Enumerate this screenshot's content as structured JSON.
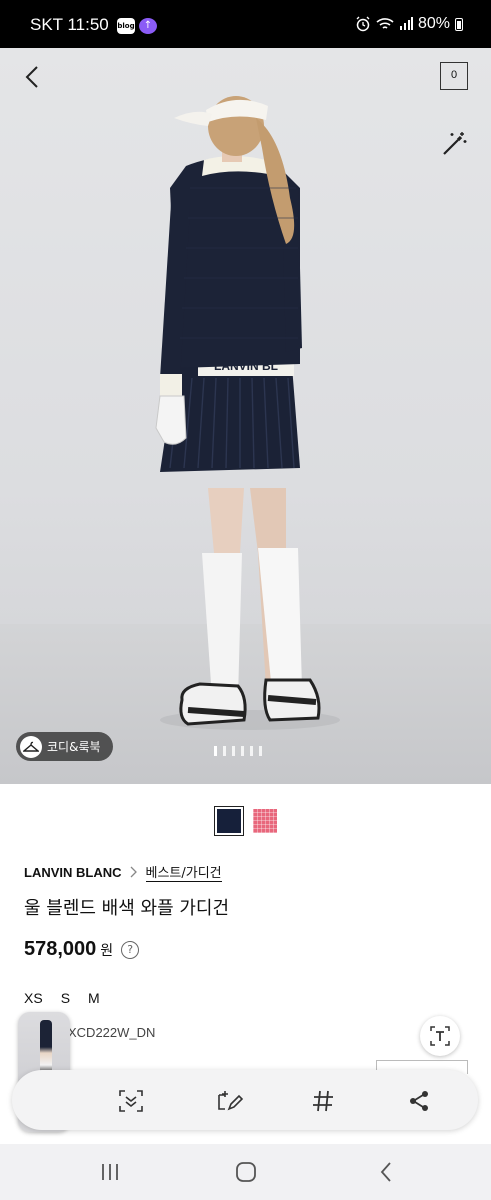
{
  "status_bar": {
    "time": "SKT 11:50",
    "blog_chip": "blog",
    "upload_chip": "↑",
    "battery": "80%"
  },
  "hero": {
    "cart_count": "0",
    "codi_label": "코디&룩북",
    "slide_count": 6,
    "active_slide": 1,
    "logo_band_text": "LANVIN BL"
  },
  "product": {
    "colors": [
      {
        "name": "navy",
        "hex": "#16203a"
      },
      {
        "name": "pink",
        "hex": "#e8677c"
      }
    ],
    "brand": "LANVIN BLANC",
    "category": "베스트/가디건",
    "title": "울 블렌드 배색 와플 가디건",
    "price": "578,000",
    "currency": "원",
    "help": "?",
    "sizes": [
      "XS",
      "S",
      "M"
    ],
    "sku": "XCD222W_DN"
  },
  "toolbar": {
    "icons": [
      "scan-icon",
      "edit-icon",
      "hashtag-icon",
      "share-icon"
    ]
  }
}
